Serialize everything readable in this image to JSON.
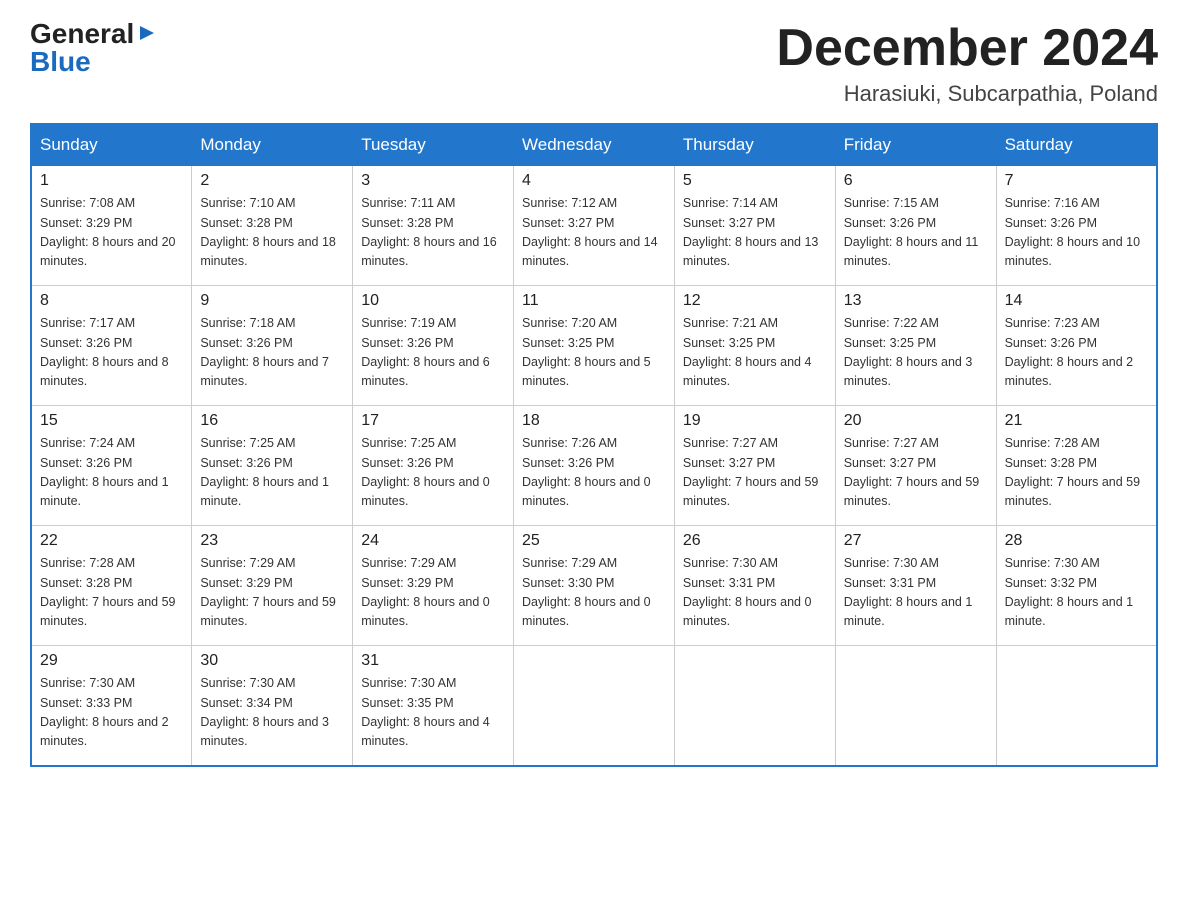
{
  "header": {
    "logo": {
      "general": "General",
      "blue": "Blue",
      "arrow": "▶"
    },
    "month": "December 2024",
    "location": "Harasiuki, Subcarpathia, Poland"
  },
  "weekdays": [
    "Sunday",
    "Monday",
    "Tuesday",
    "Wednesday",
    "Thursday",
    "Friday",
    "Saturday"
  ],
  "weeks": [
    [
      {
        "day": "1",
        "sunrise": "7:08 AM",
        "sunset": "3:29 PM",
        "daylight": "8 hours and 20 minutes."
      },
      {
        "day": "2",
        "sunrise": "7:10 AM",
        "sunset": "3:28 PM",
        "daylight": "8 hours and 18 minutes."
      },
      {
        "day": "3",
        "sunrise": "7:11 AM",
        "sunset": "3:28 PM",
        "daylight": "8 hours and 16 minutes."
      },
      {
        "day": "4",
        "sunrise": "7:12 AM",
        "sunset": "3:27 PM",
        "daylight": "8 hours and 14 minutes."
      },
      {
        "day": "5",
        "sunrise": "7:14 AM",
        "sunset": "3:27 PM",
        "daylight": "8 hours and 13 minutes."
      },
      {
        "day": "6",
        "sunrise": "7:15 AM",
        "sunset": "3:26 PM",
        "daylight": "8 hours and 11 minutes."
      },
      {
        "day": "7",
        "sunrise": "7:16 AM",
        "sunset": "3:26 PM",
        "daylight": "8 hours and 10 minutes."
      }
    ],
    [
      {
        "day": "8",
        "sunrise": "7:17 AM",
        "sunset": "3:26 PM",
        "daylight": "8 hours and 8 minutes."
      },
      {
        "day": "9",
        "sunrise": "7:18 AM",
        "sunset": "3:26 PM",
        "daylight": "8 hours and 7 minutes."
      },
      {
        "day": "10",
        "sunrise": "7:19 AM",
        "sunset": "3:26 PM",
        "daylight": "8 hours and 6 minutes."
      },
      {
        "day": "11",
        "sunrise": "7:20 AM",
        "sunset": "3:25 PM",
        "daylight": "8 hours and 5 minutes."
      },
      {
        "day": "12",
        "sunrise": "7:21 AM",
        "sunset": "3:25 PM",
        "daylight": "8 hours and 4 minutes."
      },
      {
        "day": "13",
        "sunrise": "7:22 AM",
        "sunset": "3:25 PM",
        "daylight": "8 hours and 3 minutes."
      },
      {
        "day": "14",
        "sunrise": "7:23 AM",
        "sunset": "3:26 PM",
        "daylight": "8 hours and 2 minutes."
      }
    ],
    [
      {
        "day": "15",
        "sunrise": "7:24 AM",
        "sunset": "3:26 PM",
        "daylight": "8 hours and 1 minute."
      },
      {
        "day": "16",
        "sunrise": "7:25 AM",
        "sunset": "3:26 PM",
        "daylight": "8 hours and 1 minute."
      },
      {
        "day": "17",
        "sunrise": "7:25 AM",
        "sunset": "3:26 PM",
        "daylight": "8 hours and 0 minutes."
      },
      {
        "day": "18",
        "sunrise": "7:26 AM",
        "sunset": "3:26 PM",
        "daylight": "8 hours and 0 minutes."
      },
      {
        "day": "19",
        "sunrise": "7:27 AM",
        "sunset": "3:27 PM",
        "daylight": "7 hours and 59 minutes."
      },
      {
        "day": "20",
        "sunrise": "7:27 AM",
        "sunset": "3:27 PM",
        "daylight": "7 hours and 59 minutes."
      },
      {
        "day": "21",
        "sunrise": "7:28 AM",
        "sunset": "3:28 PM",
        "daylight": "7 hours and 59 minutes."
      }
    ],
    [
      {
        "day": "22",
        "sunrise": "7:28 AM",
        "sunset": "3:28 PM",
        "daylight": "7 hours and 59 minutes."
      },
      {
        "day": "23",
        "sunrise": "7:29 AM",
        "sunset": "3:29 PM",
        "daylight": "7 hours and 59 minutes."
      },
      {
        "day": "24",
        "sunrise": "7:29 AM",
        "sunset": "3:29 PM",
        "daylight": "8 hours and 0 minutes."
      },
      {
        "day": "25",
        "sunrise": "7:29 AM",
        "sunset": "3:30 PM",
        "daylight": "8 hours and 0 minutes."
      },
      {
        "day": "26",
        "sunrise": "7:30 AM",
        "sunset": "3:31 PM",
        "daylight": "8 hours and 0 minutes."
      },
      {
        "day": "27",
        "sunrise": "7:30 AM",
        "sunset": "3:31 PM",
        "daylight": "8 hours and 1 minute."
      },
      {
        "day": "28",
        "sunrise": "7:30 AM",
        "sunset": "3:32 PM",
        "daylight": "8 hours and 1 minute."
      }
    ],
    [
      {
        "day": "29",
        "sunrise": "7:30 AM",
        "sunset": "3:33 PM",
        "daylight": "8 hours and 2 minutes."
      },
      {
        "day": "30",
        "sunrise": "7:30 AM",
        "sunset": "3:34 PM",
        "daylight": "8 hours and 3 minutes."
      },
      {
        "day": "31",
        "sunrise": "7:30 AM",
        "sunset": "3:35 PM",
        "daylight": "8 hours and 4 minutes."
      },
      null,
      null,
      null,
      null
    ]
  ],
  "labels": {
    "sunrise": "Sunrise:",
    "sunset": "Sunset:",
    "daylight": "Daylight:"
  }
}
